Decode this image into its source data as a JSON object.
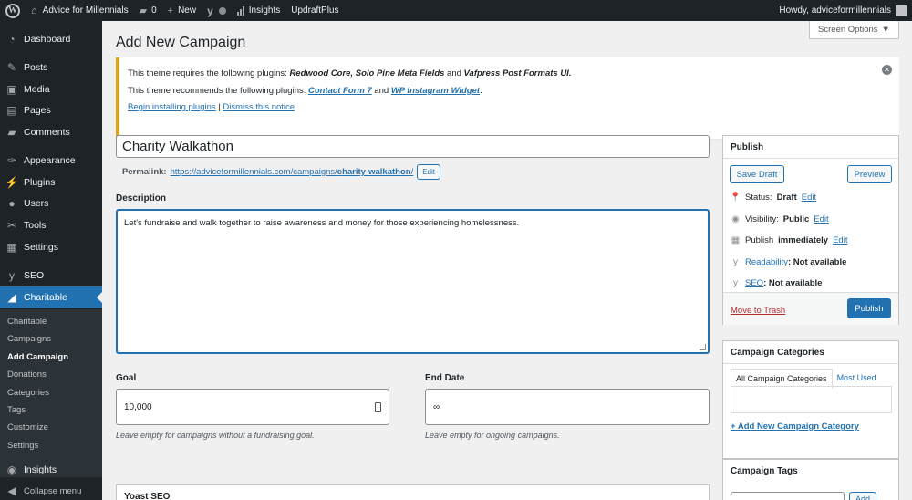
{
  "adminbar": {
    "site_name": "Advice for Millennials",
    "comments_count": "0",
    "new_label": "New",
    "insights_label": "Insights",
    "updraft_label": "UpdraftPlus",
    "howdy": "Howdy, adviceformillennials"
  },
  "sidebar": {
    "items": [
      {
        "label": "Dashboard",
        "icon": "dashboard-icon"
      },
      {
        "label": "Posts",
        "icon": "pushpin-icon"
      },
      {
        "label": "Media",
        "icon": "media-icon"
      },
      {
        "label": "Pages",
        "icon": "page-icon"
      },
      {
        "label": "Comments",
        "icon": "comment-icon"
      },
      {
        "label": "Appearance",
        "icon": "paintbrush-icon"
      },
      {
        "label": "Plugins",
        "icon": "plug-icon"
      },
      {
        "label": "Users",
        "icon": "user-icon"
      },
      {
        "label": "Tools",
        "icon": "wrench-icon"
      },
      {
        "label": "Settings",
        "icon": "settings-icon"
      },
      {
        "label": "SEO",
        "icon": "yoast-icon"
      },
      {
        "label": "Charitable",
        "icon": "charitable-icon"
      }
    ],
    "submenu": [
      "Charitable",
      "Campaigns",
      "Add Campaign",
      "Donations",
      "Categories",
      "Tags",
      "Customize",
      "Settings"
    ],
    "insights": "Insights",
    "collapse": "Collapse menu"
  },
  "main": {
    "page_title": "Add New Campaign",
    "screen_options": "Screen Options",
    "notice": {
      "line1_prefix": "This theme requires the following plugins: ",
      "line1_plugins": "Redwood Core, Solo Pine Meta Fields",
      "line1_and": " and ",
      "line1_last": "Vafpress Post Formats UI",
      "line1_end": ".",
      "line2_prefix": "This theme recommends the following plugins: ",
      "line2_link1": "Contact Form 7",
      "line2_and": " and ",
      "line2_link2": "WP Instagram Widget",
      "line2_end": ".",
      "begin_link": "Begin installing plugins",
      "separator": " | ",
      "dismiss_link": "Dismiss this notice"
    },
    "title_value": "Charity Walkathon",
    "permalink_label": "Permalink:",
    "permalink_base": "https://adviceformillennials.com/campaigns/",
    "permalink_slug": "charity-walkathon",
    "permalink_end": "/",
    "edit_label": "Edit",
    "description_label": "Description",
    "description_value": "Let's fundraise and walk together to raise awareness and money for those experiencing homelessness.",
    "goal_label": "Goal",
    "goal_value": "10,000",
    "goal_hint": "Leave empty for campaigns without a fundraising goal.",
    "end_date_label": "End Date",
    "end_date_value": "∞",
    "end_date_hint": "Leave empty for ongoing campaigns.",
    "yoast_title": "Yoast SEO"
  },
  "publish": {
    "title": "Publish",
    "save_draft": "Save Draft",
    "preview": "Preview",
    "status_label": "Status:",
    "status_value": "Draft",
    "visibility_label": "Visibility:",
    "visibility_value": "Public",
    "publish_label": "Publish",
    "publish_value": "immediately",
    "edit": "Edit",
    "readability_link": "Readability",
    "readability_value": ": Not available",
    "seo_link": "SEO",
    "seo_value": ": Not available",
    "trash": "Move to Trash",
    "publish_button": "Publish"
  },
  "categories": {
    "title": "Campaign Categories",
    "tab_all": "All Campaign Categories",
    "tab_most_used": "Most Used",
    "add_new": "+ Add New Campaign Category"
  },
  "tags": {
    "title": "Campaign Tags",
    "add": "Add"
  }
}
